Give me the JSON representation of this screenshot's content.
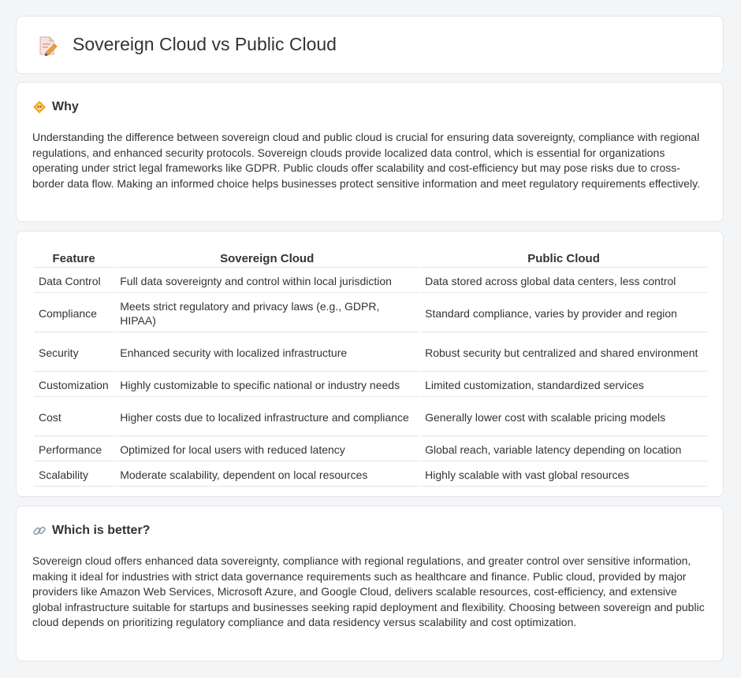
{
  "page": {
    "title": "Sovereign Cloud vs Public Cloud",
    "title_icon": "document-pencil-icon"
  },
  "why": {
    "heading": "Why",
    "icon": "diamond-warning-icon",
    "text": "Understanding the difference between sovereign cloud and public cloud is crucial for ensuring data sovereignty, compliance with regional regulations, and enhanced security protocols. Sovereign clouds provide localized data control, which is essential for organizations operating under strict legal frameworks like GDPR. Public clouds offer scalability and cost-efficiency but may pose risks due to cross-border data flow. Making an informed choice helps businesses protect sensitive information and meet regulatory requirements effectively."
  },
  "table": {
    "headers": [
      "Feature",
      "Sovereign Cloud",
      "Public Cloud"
    ],
    "rows": [
      [
        "Data Control",
        "Full data sovereignty and control within local jurisdiction",
        "Data stored across global data centers, less control"
      ],
      [
        "Compliance",
        "Meets strict regulatory and privacy laws (e.g., GDPR, HIPAA)",
        "Standard compliance, varies by provider and region"
      ],
      [
        "Security",
        "Enhanced security with localized infrastructure",
        "Robust security but centralized and shared environment"
      ],
      [
        "Customization",
        "Highly customizable to specific national or industry needs",
        "Limited customization, standardized services"
      ],
      [
        "Cost",
        "Higher costs due to localized infrastructure and compliance",
        "Generally lower cost with scalable pricing models"
      ],
      [
        "Performance",
        "Optimized for local users with reduced latency",
        "Global reach, variable latency depending on location"
      ],
      [
        "Scalability",
        "Moderate scalability, dependent on local resources",
        "Highly scalable with vast global resources"
      ]
    ]
  },
  "better": {
    "heading": "Which is better?",
    "icon": "link-icon",
    "text": "Sovereign cloud offers enhanced data sovereignty, compliance with regional regulations, and greater control over sensitive information, making it ideal for industries with strict data governance requirements such as healthcare and finance. Public cloud, provided by major providers like Amazon Web Services, Microsoft Azure, and Google Cloud, delivers scalable resources, cost-efficiency, and extensive global infrastructure suitable for startups and businesses seeking rapid deployment and flexibility. Choosing between sovereign and public cloud depends on prioritizing regulatory compliance and data residency versus scalability and cost optimization."
  }
}
